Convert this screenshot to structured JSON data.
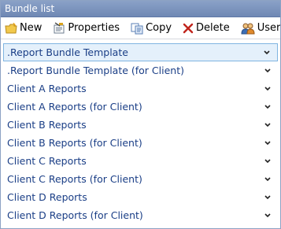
{
  "panel": {
    "title": "Bundle list"
  },
  "toolbar": {
    "new_label": "New",
    "properties_label": "Properties",
    "copy_label": "Copy",
    "delete_label": "Delete",
    "users_label": "Users"
  },
  "bundles": {
    "selected_index": 0,
    "items": [
      {
        "label": ".Report Bundle Template"
      },
      {
        "label": ".Report Bundle Template (for Client)"
      },
      {
        "label": "Client A Reports"
      },
      {
        "label": "Client A Reports (for Client)"
      },
      {
        "label": "Client B Reports"
      },
      {
        "label": "Client B Reports (for Client)"
      },
      {
        "label": "Client C Reports"
      },
      {
        "label": "Client C Reports (for Client)"
      },
      {
        "label": "Client D Reports"
      },
      {
        "label": "Client D Reports (for Client)"
      }
    ]
  },
  "colors": {
    "titlebar": "#7a92bd",
    "item_text": "#1a3e86",
    "selected_bg": "#e4f0fb",
    "selected_border": "#7fb4e1",
    "delete_icon": "#c0241c"
  },
  "icons": {
    "new": "new-folder-icon",
    "properties": "properties-icon",
    "copy": "copy-icon",
    "delete": "delete-x-icon",
    "users": "users-icon",
    "expand": "chevron-down-icon"
  }
}
